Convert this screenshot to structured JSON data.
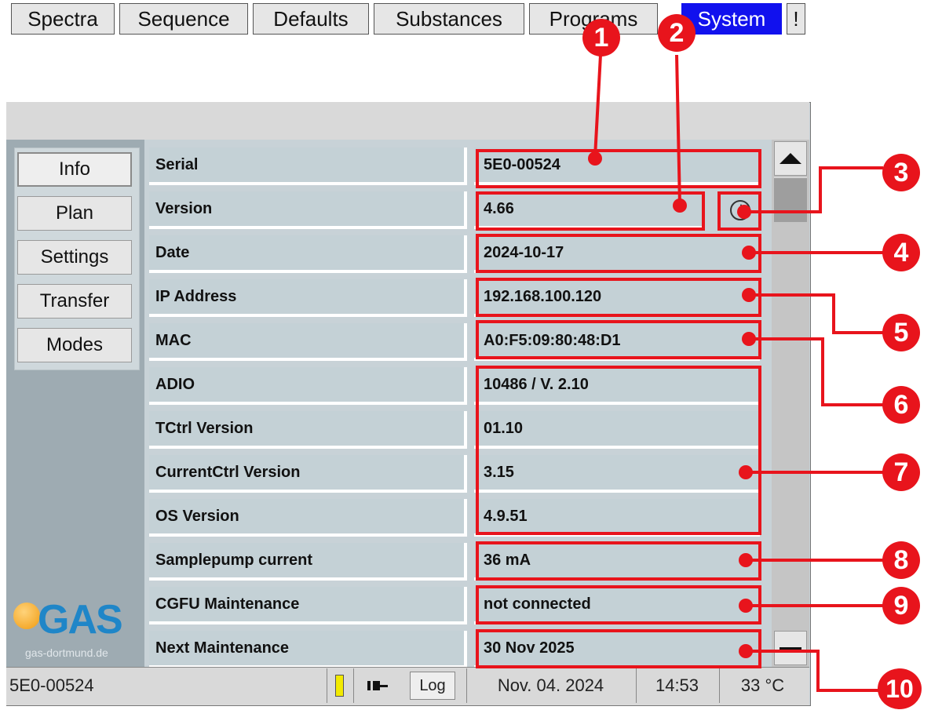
{
  "tabs": [
    {
      "label": "Spectra"
    },
    {
      "label": "Sequence"
    },
    {
      "label": "Defaults"
    },
    {
      "label": "Substances"
    },
    {
      "label": "Programs"
    },
    {
      "label": "System"
    },
    {
      "label": "!"
    }
  ],
  "sidebar": {
    "items": [
      {
        "label": "Info"
      },
      {
        "label": "Plan"
      },
      {
        "label": "Settings"
      },
      {
        "label": "Transfer"
      },
      {
        "label": "Modes"
      }
    ]
  },
  "logo": {
    "text": "GAS",
    "subtitle": "gas-dortmund.de"
  },
  "info_rows": [
    {
      "label": "Serial",
      "value": "5E0-00524"
    },
    {
      "label": "Version",
      "value": "4.66"
    },
    {
      "label": "Date",
      "value": "2024-10-17"
    },
    {
      "label": "IP Address",
      "value": "192.168.100.120"
    },
    {
      "label": "MAC",
      "value": "A0:F5:09:80:48:D1"
    },
    {
      "label": "ADIO",
      "value": "10486 / V. 2.10"
    },
    {
      "label": "TCtrl Version",
      "value": "01.10"
    },
    {
      "label": "CurrentCtrl Version",
      "value": "3.15"
    },
    {
      "label": "OS Version",
      "value": "4.9.51"
    },
    {
      "label": "Samplepump current",
      "value": "36 mA"
    },
    {
      "label": "CGFU Maintenance",
      "value": "not connected"
    },
    {
      "label": "Next Maintenance",
      "value": "30 Nov 2025"
    }
  ],
  "info_icon": "info-circle-icon",
  "statusbar": {
    "serial": "5E0-00524",
    "log_label": "Log",
    "date": "Nov. 04. 2024",
    "time": "14:53",
    "temperature": "33 °C"
  },
  "callouts": [
    "1",
    "2",
    "3",
    "4",
    "5",
    "6",
    "7",
    "8",
    "9",
    "10"
  ],
  "colors": {
    "accent_red": "#e8141c",
    "active_tab": "#1111ee",
    "logo_blue": "#1f86c8"
  }
}
